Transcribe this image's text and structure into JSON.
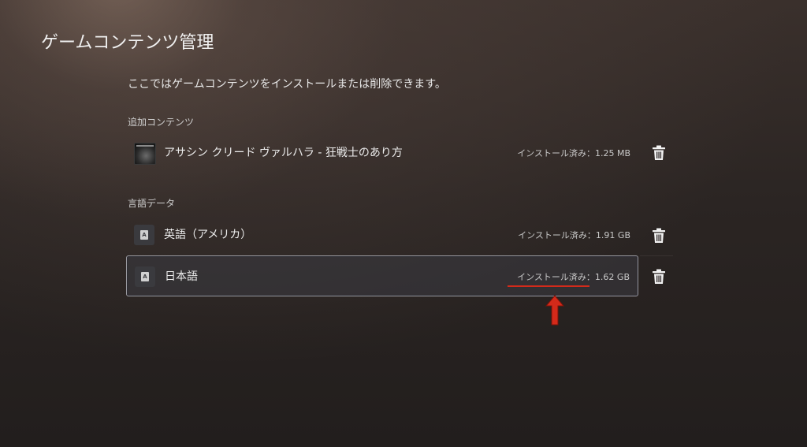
{
  "page": {
    "title": "ゲームコンテンツ管理",
    "description": "ここではゲームコンテンツをインストールまたは削除できます。"
  },
  "sections": {
    "addon": {
      "label": "追加コンテンツ",
      "items": [
        {
          "name": "アサシン クリード ヴァルハラ - 狂戦士のあり方",
          "size": "インストール済み：1.25 MB"
        }
      ]
    },
    "language": {
      "label": "言語データ",
      "items": [
        {
          "name": "英語（アメリカ）",
          "size": "インストール済み：1.91 GB"
        },
        {
          "name": "日本語",
          "size": "インストール済み：1.62 GB"
        }
      ]
    }
  },
  "icons": {
    "delete": "trash-icon",
    "language": "language-icon",
    "thumbnail": "addon-thumbnail"
  },
  "colors": {
    "annotation": "#d42a1a",
    "focus_border": "#9a9aa0"
  }
}
